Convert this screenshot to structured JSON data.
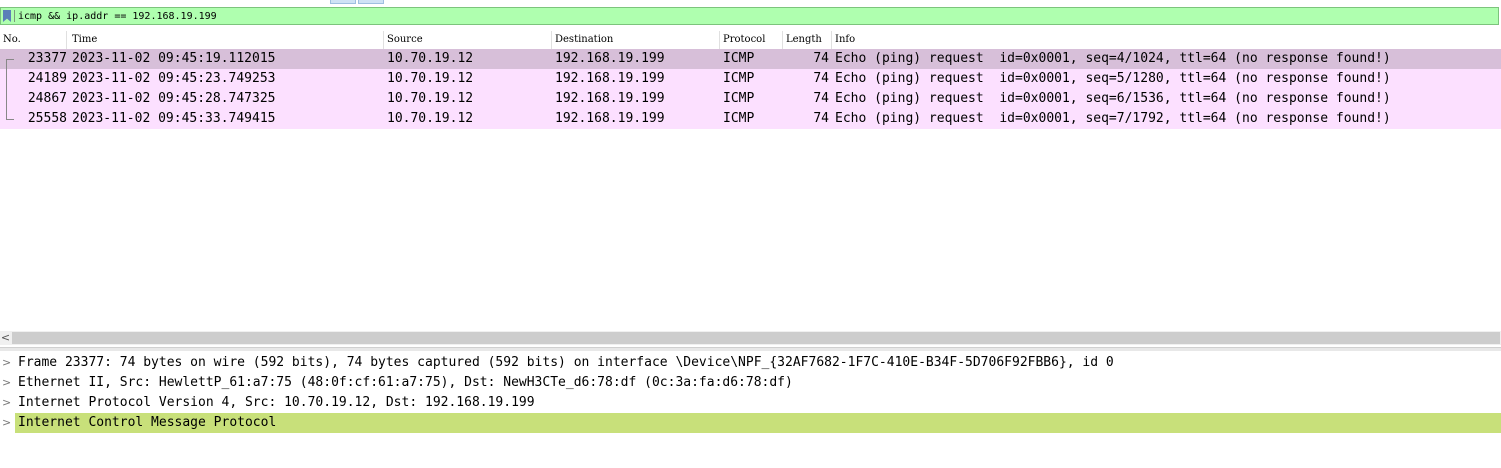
{
  "filter": {
    "value": "icmp && ip.addr == 192.168.19.199"
  },
  "packet_list": {
    "columns": [
      "No.",
      "Time",
      "Source",
      "Destination",
      "Protocol",
      "Length",
      "Info"
    ],
    "rows": [
      {
        "no": "23377",
        "time": "2023-11-02 09:45:19.112015",
        "source": "10.70.19.12",
        "destination": "192.168.19.199",
        "protocol": "ICMP",
        "length": "74",
        "info": "Echo (ping) request  id=0x0001, seq=4/1024, ttl=64 (no response found!)"
      },
      {
        "no": "24189",
        "time": "2023-11-02 09:45:23.749253",
        "source": "10.70.19.12",
        "destination": "192.168.19.199",
        "protocol": "ICMP",
        "length": "74",
        "info": "Echo (ping) request  id=0x0001, seq=5/1280, ttl=64 (no response found!)"
      },
      {
        "no": "24867",
        "time": "2023-11-02 09:45:28.747325",
        "source": "10.70.19.12",
        "destination": "192.168.19.199",
        "protocol": "ICMP",
        "length": "74",
        "info": "Echo (ping) request  id=0x0001, seq=6/1536, ttl=64 (no response found!)"
      },
      {
        "no": "25558",
        "time": "2023-11-02 09:45:33.749415",
        "source": "10.70.19.12",
        "destination": "192.168.19.199",
        "protocol": "ICMP",
        "length": "74",
        "info": "Echo (ping) request  id=0x0001, seq=7/1792, ttl=64 (no response found!)"
      }
    ]
  },
  "scrollbar": {
    "left_arrow": "<"
  },
  "details": {
    "expand_glyph": ">",
    "items": [
      "Frame 23377: 74 bytes on wire (592 bits), 74 bytes captured (592 bits) on interface \\Device\\NPF_{32AF7682-1F7C-410E-B34F-5D706F92FBB6}, id 0",
      "Ethernet II, Src: HewlettP_61:a7:75 (48:0f:cf:61:a7:75), Dst: NewH3CTe_d6:78:df (0c:3a:fa:d6:78:df)",
      "Internet Protocol Version 4, Src: 10.70.19.12, Dst: 192.168.19.199",
      "Internet Control Message Protocol"
    ]
  },
  "colors": {
    "filter_valid": "#afffaf",
    "icmp_row": "#fce0ff",
    "selected_row": "#d7bfd9",
    "detail_highlight": "#c8e07a"
  }
}
